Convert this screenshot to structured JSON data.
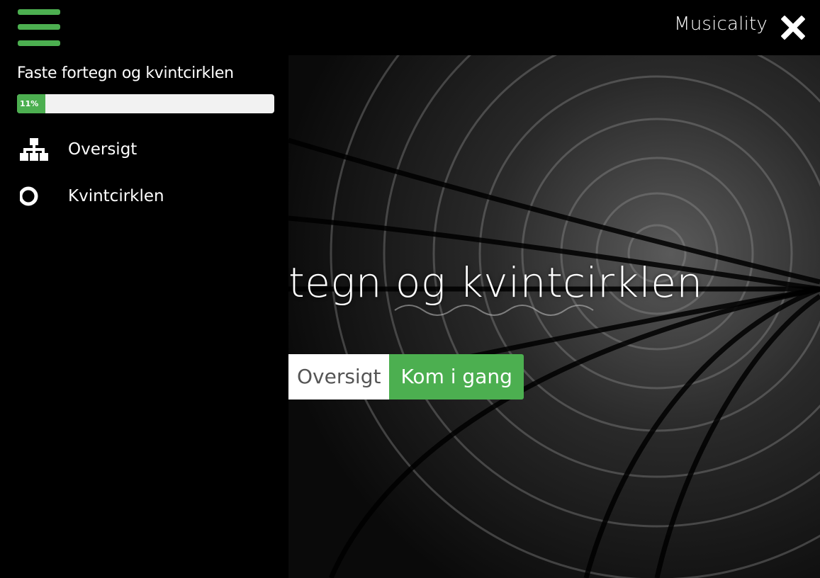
{
  "header": {
    "brand": "Musicality",
    "menu_icon": "hamburger-icon",
    "close_icon": "close-x-icon"
  },
  "sidebar": {
    "course_title": "Faste fortegn og kvintcirklen",
    "progress": {
      "percent": 11,
      "label": "11%"
    },
    "items": [
      {
        "label": "Oversigt",
        "icon": "sitemap-icon"
      },
      {
        "label": "Kvintcirklen",
        "icon": "circle-icon"
      }
    ]
  },
  "hero": {
    "title": "tegn og kvintcirklen",
    "overview_button": "Oversigt",
    "start_button": "Kom i gang"
  },
  "colors": {
    "accent": "#4caf50",
    "background": "#000000",
    "text": "#ffffff"
  }
}
